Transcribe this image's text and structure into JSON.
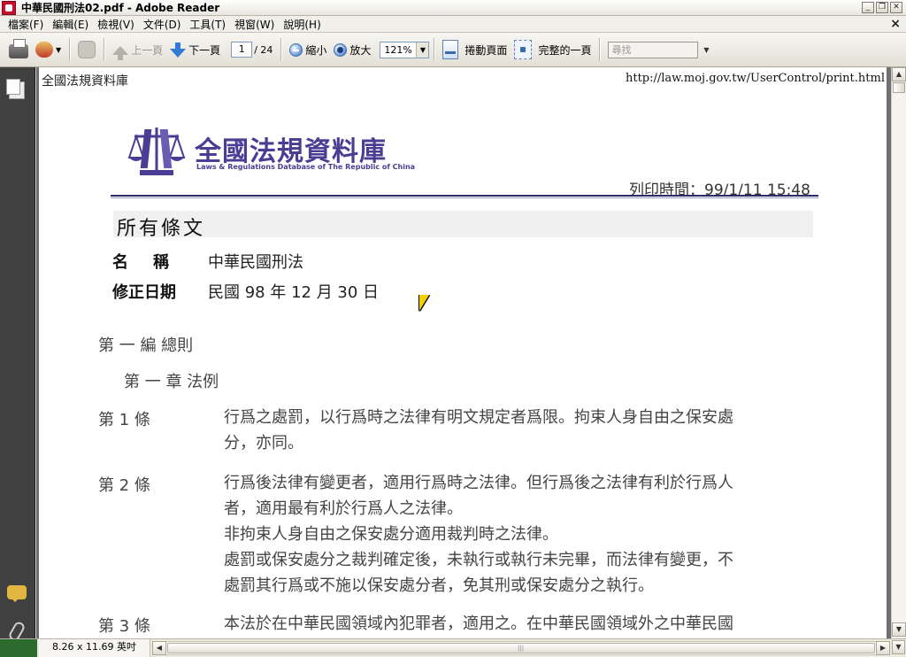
{
  "window": {
    "title": "中華民國刑法02.pdf - Adobe Reader",
    "controls": [
      "minimize",
      "restore",
      "close"
    ]
  },
  "menu": {
    "items": [
      "檔案(F)",
      "編輯(E)",
      "檢視(V)",
      "文件(D)",
      "工具(T)",
      "視窗(W)",
      "說明(H)"
    ],
    "close_glyph": "×"
  },
  "toolbar": {
    "prev_page": "上一頁",
    "next_page": "下一頁",
    "page_current": "1",
    "page_total": "/ 24",
    "zoom_out": "縮小",
    "zoom_in": "放大",
    "zoom_value": "121%",
    "scroll_page": "捲動頁面",
    "fit_page": "完整的一頁",
    "search_placeholder": "尋找"
  },
  "document": {
    "header_left": "全國法規資料庫",
    "header_right": "http://law.moj.gov.tw/UserControl/print.html",
    "logo_title": "全國法規資料庫",
    "logo_subtitle": "Laws & Regulations Database of The Republic of China",
    "print_time": "列印時間：99/1/11 15:48",
    "section_title": "所有條文",
    "name_label": "名稱",
    "name_value": "中華民國刑法",
    "date_label": "修正日期",
    "date_value": "民國 98 年 12 月 30 日",
    "part": "第 一 編 總則",
    "chapter": "第 一 章 法例",
    "articles": [
      {
        "num": "第 1 條",
        "lines": [
          "行爲之處罰，以行爲時之法律有明文規定者爲限。拘束人身自由之保安處",
          "分，亦同。"
        ]
      },
      {
        "num": "第 2 條",
        "lines": [
          "行爲後法律有變更者，適用行爲時之法律。但行爲後之法律有利於行爲人",
          "者，適用最有利於行爲人之法律。",
          "非拘束人身自由之保安處分適用裁判時之法律。",
          "處罰或保安處分之裁判確定後，未執行或執行未完畢，而法律有變更，不",
          "處罰其行爲或不施以保安處分者，免其刑或保安處分之執行。"
        ]
      },
      {
        "num": "第 3 條",
        "lines": [
          "本法於在中華民國領域內犯罪者，適用之。在中華民國領域外之中華民國"
        ]
      }
    ]
  },
  "status": {
    "page_size": "8.26 x 11.69 英吋"
  },
  "colors": {
    "logo_purple": "#4b3d93",
    "nav_dark": "#404040",
    "doc_bg": "#6f6f6f",
    "status_green": "#2c6b2f"
  }
}
